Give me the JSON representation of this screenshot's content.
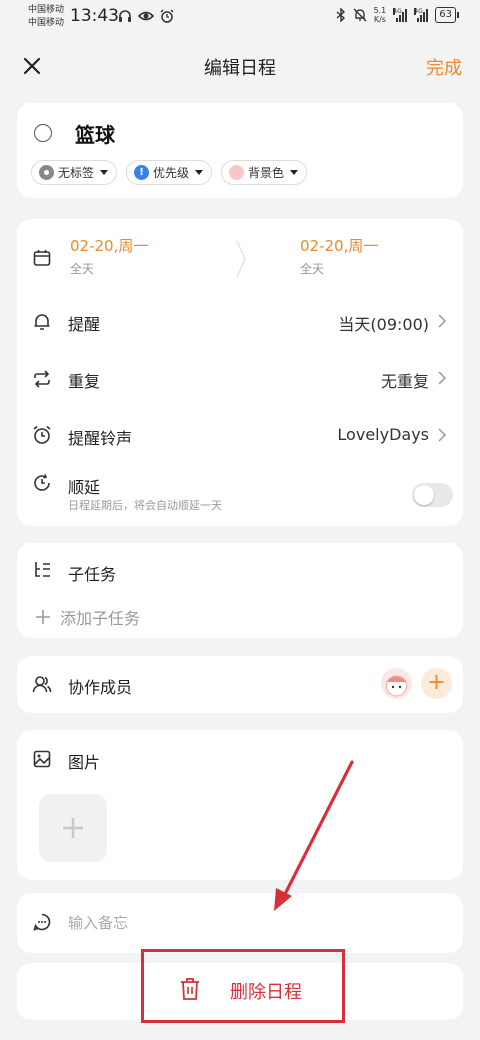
{
  "status_bar": {
    "carrier_1": "中国移动",
    "carrier_2": "中国移动",
    "time": "13:43",
    "net_speed_value": "5.1",
    "net_speed_unit": "K/s",
    "signal_1_label": "4G",
    "signal_2_label": "4G",
    "battery": "63"
  },
  "header": {
    "title": "编辑日程",
    "done_label": "完成"
  },
  "task": {
    "title": "篮球",
    "chips": {
      "tag": "无标签",
      "priority_symbol": "!",
      "priority": "优先级",
      "background": "背景色"
    }
  },
  "schedule": {
    "start_date": "02-20,周一",
    "start_sub": "全天",
    "end_date": "02-20,周一",
    "end_sub": "全天",
    "reminder_label": "提醒",
    "reminder_value": "当天(09:00)",
    "repeat_label": "重复",
    "repeat_value": "无重复",
    "ringtone_label": "提醒铃声",
    "ringtone_value": "LovelyDays",
    "postpone_label": "顺延",
    "postpone_note": "日程延期后，将会自动顺延一天"
  },
  "subtasks": {
    "title": "子任务",
    "add_label": "添加子任务"
  },
  "members": {
    "title": "协作成员",
    "add_symbol": "+"
  },
  "images": {
    "title": "图片"
  },
  "memo": {
    "placeholder": "输入备忘"
  },
  "delete": {
    "label": "删除日程"
  },
  "colors": {
    "accent": "#e88a2e",
    "danger": "#d8303a",
    "priority_blue": "#3b82e6",
    "background_pink": "#f9c7c7"
  }
}
